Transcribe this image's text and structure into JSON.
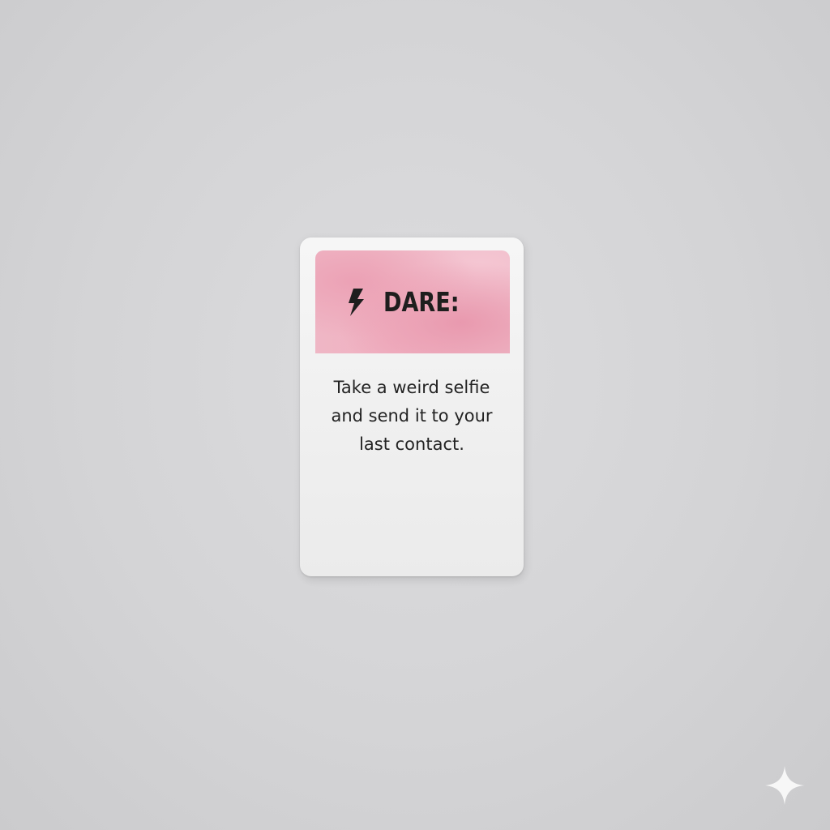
{
  "card": {
    "title": "DARE:",
    "icon": "lightning-bolt-icon",
    "lines": [
      "Take a weird selfie",
      "and send it to your",
      "last contact."
    ],
    "header_color": "#efb8c6",
    "card_color": "#f3f3f3"
  },
  "background_color": "#d6d6d8",
  "watermark_icon": "sparkle-icon"
}
